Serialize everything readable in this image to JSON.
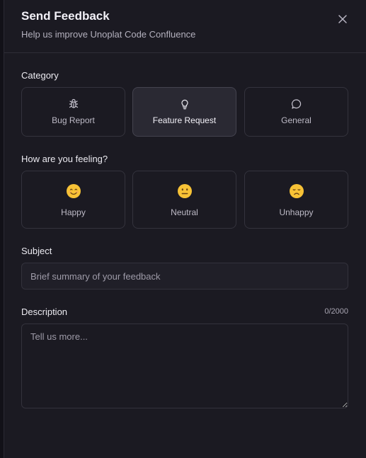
{
  "header": {
    "title": "Send Feedback",
    "subtitle": "Help us improve Unoplat Code Confluence"
  },
  "category": {
    "label": "Category",
    "selected": "Feature Request",
    "options": [
      {
        "label": "Bug Report",
        "icon": "bug-icon"
      },
      {
        "label": "Feature Request",
        "icon": "lightbulb-icon"
      },
      {
        "label": "General",
        "icon": "chat-bubble-icon"
      }
    ]
  },
  "mood": {
    "label": "How are you feeling?",
    "options": [
      {
        "label": "Happy",
        "icon": "smiling-face-icon"
      },
      {
        "label": "Neutral",
        "icon": "neutral-face-icon"
      },
      {
        "label": "Unhappy",
        "icon": "disappointed-face-icon"
      }
    ]
  },
  "subject": {
    "label": "Subject",
    "placeholder": "Brief summary of your feedback",
    "value": ""
  },
  "description": {
    "label": "Description",
    "counter": "0/2000",
    "placeholder": "Tell us more...",
    "value": ""
  },
  "colors": {
    "background": "#1b1a22",
    "selected_card": "#2a2933",
    "border": "#34333d",
    "emoji_yellow": "#f7c236"
  }
}
